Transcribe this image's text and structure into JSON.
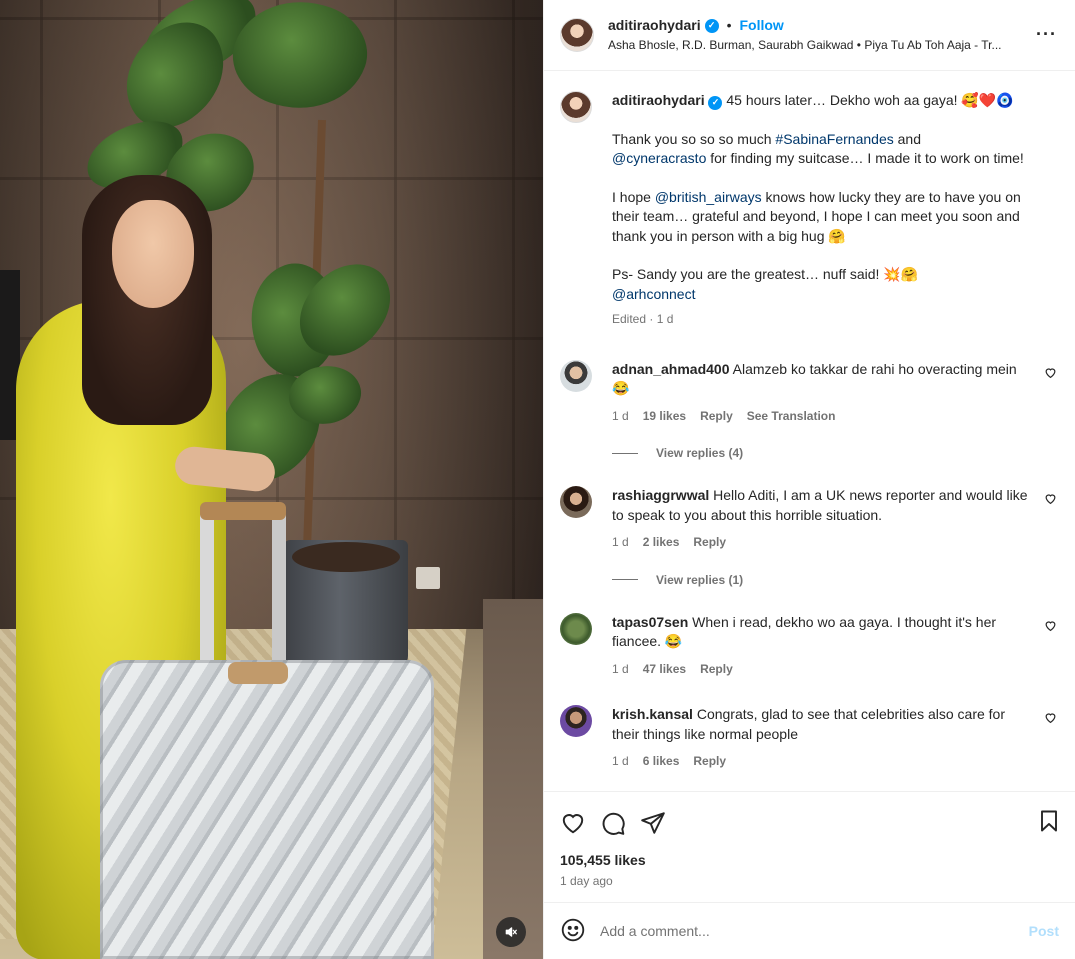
{
  "header": {
    "username": "aditiraohydari",
    "follow_label": "Follow",
    "audio": "Asha Bhosle, R.D. Burman, Saurabh Gaikwad • Piya Tu Ab Toh Aaja - Tr..."
  },
  "caption": {
    "username": "aditiraohydari",
    "line1": "45 hours later… Dekho woh aa gaya! 🥰❤️🧿",
    "p1_a": "Thank you so so so much ",
    "p1_hashtag": "#SabinaFernandes",
    "p1_b": " and ",
    "p1_mention": "@cyneracrasto",
    "p1_c": " for finding my suitcase… I made it to work on time!",
    "p2_a": "I hope ",
    "p2_mention": "@british_airways",
    "p2_b": " knows how lucky they are to have you on their team… grateful and beyond, I hope I can meet you soon and thank you in person with a big hug 🤗",
    "p3_a": "Ps- Sandy you are the greatest… nuff said! 💥🤗",
    "p3_mention": "@arhconnect",
    "meta": "Edited · 1 d"
  },
  "comments": [
    {
      "username": "adnan_ahmad400",
      "text": "Alamzeb ko takkar de rahi ho overacting mein 😂",
      "age": "1 d",
      "likes": "19 likes",
      "reply": "Reply",
      "translate": "See Translation",
      "replies": "View replies (4)"
    },
    {
      "username": "rashiaggrwwal",
      "text": "Hello Aditi, I am a UK news reporter and would like to speak to you about this horrible situation.",
      "age": "1 d",
      "likes": "2 likes",
      "reply": "Reply",
      "replies": "View replies (1)"
    },
    {
      "username": "tapas07sen",
      "text": "When i read, dekho wo aa gaya. I thought it's her fiancee. 😂",
      "age": "1 d",
      "likes": "47 likes",
      "reply": "Reply"
    },
    {
      "username": "krish.kansal",
      "text": "Congrats, glad to see that celebrities also care for their things like normal people",
      "age": "1 d",
      "likes": "6 likes",
      "reply": "Reply"
    }
  ],
  "footer": {
    "likes": "105,455 likes",
    "time": "1 day ago",
    "comment_placeholder": "Add a comment...",
    "post_label": "Post"
  },
  "colors": {
    "accent": "#0095f6",
    "link": "#00376b",
    "muted": "#737373"
  }
}
